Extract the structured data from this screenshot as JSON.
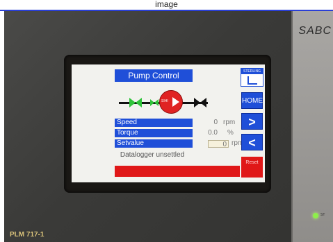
{
  "header": {
    "caption": "image"
  },
  "device": {
    "brand": "SABC",
    "model": "PLM 717-1",
    "led_label": "ST"
  },
  "screen": {
    "title": "Pump Control",
    "logo_text": "STERLING",
    "pump_label": "SIHI",
    "rows": [
      {
        "label": "Speed",
        "value": "0",
        "unit": "rpm"
      },
      {
        "label": "Torque",
        "value": "0.0",
        "unit": "%"
      },
      {
        "label": "Setvalue",
        "value": "0",
        "unit": "rpm"
      }
    ],
    "status": "Datalogger unsettled",
    "alarm_text": "",
    "nav": {
      "home": "HOME",
      "next": ">",
      "prev": "<"
    },
    "reset_label": "Reset",
    "colors": {
      "accent": "#1f4fd8",
      "alarm": "#e01818",
      "valve_green": "#2ec43a",
      "pump_red": "#e02323"
    }
  }
}
